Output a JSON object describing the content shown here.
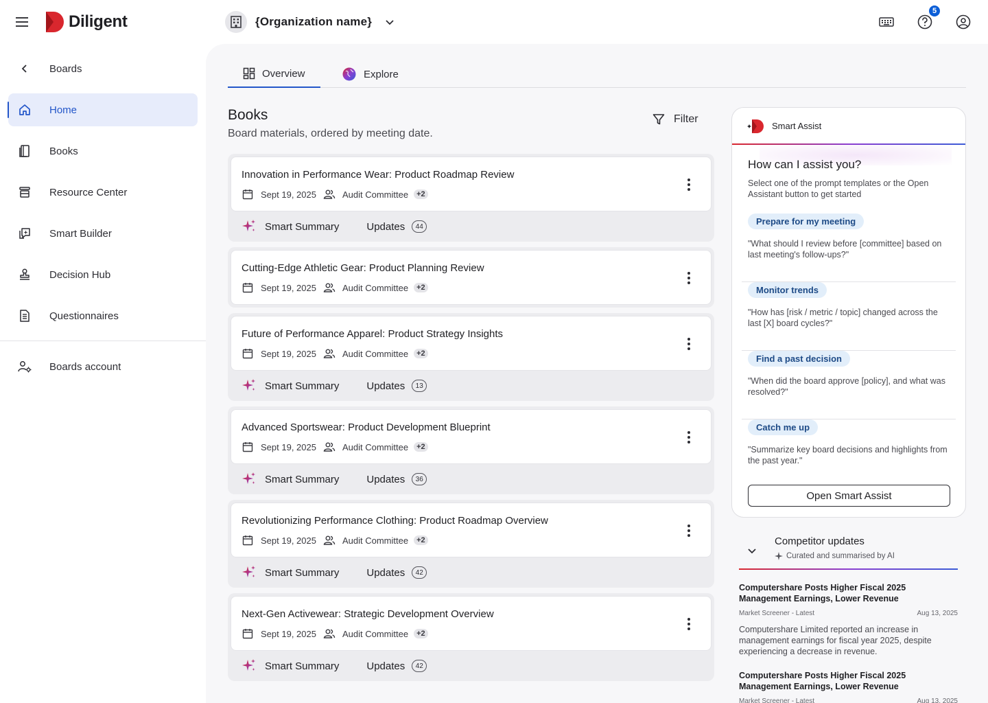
{
  "app": {
    "brand": "Diligent"
  },
  "header": {
    "org_name": "{Organization name}",
    "notification_count": "5"
  },
  "sidebar": {
    "back_label": "Boards",
    "items": [
      {
        "label": "Home",
        "icon": "home-icon",
        "active": true
      },
      {
        "label": "Books",
        "icon": "book-icon"
      },
      {
        "label": "Resource Center",
        "icon": "archive-icon"
      },
      {
        "label": "Smart Builder",
        "icon": "smart-builder-icon"
      },
      {
        "label": "Decision Hub",
        "icon": "stamp-icon"
      },
      {
        "label": "Questionnaires",
        "icon": "document-icon"
      }
    ],
    "account_label": "Boards account"
  },
  "tabs": [
    {
      "label": "Overview",
      "active": true
    },
    {
      "label": "Explore"
    }
  ],
  "books_section": {
    "title": "Books",
    "subtitle": "Board materials, ordered by meeting date.",
    "filter_label": "Filter",
    "footer_summary_label": "Smart Summary",
    "footer_updates_label": "Updates",
    "items": [
      {
        "title": "Innovation in Performance Wear: Product Roadmap Review",
        "date": "Sept 19, 2025",
        "committee": "Audit Committee",
        "extra": "+2",
        "updates": "44"
      },
      {
        "title": "Cutting-Edge Athletic Gear: Product Planning Review",
        "date": "Sept 19, 2025",
        "committee": "Audit Committee",
        "extra": "+2",
        "updates": ""
      },
      {
        "title": "Future of Performance Apparel: Product Strategy Insights",
        "date": "Sept 19, 2025",
        "committee": "Audit Committee",
        "extra": "+2",
        "updates": "13"
      },
      {
        "title": "Advanced Sportswear: Product Development Blueprint",
        "date": "Sept 19, 2025",
        "committee": "Audit Committee",
        "extra": "+2",
        "updates": "36"
      },
      {
        "title": "Revolutionizing Performance Clothing: Product Roadmap Overview",
        "date": "Sept 19, 2025",
        "committee": "Audit Committee",
        "extra": "+2",
        "updates": "42"
      },
      {
        "title": "Next-Gen Activewear: Strategic Development Overview",
        "date": "Sept 19, 2025",
        "committee": "Audit Committee",
        "extra": "+2",
        "updates": "42"
      }
    ]
  },
  "smart_assist": {
    "title": "Smart Assist",
    "question": "How can I assist you?",
    "description": "Select one of the prompt templates or the Open Assistant button to get started",
    "prompts": [
      {
        "label": "Prepare for my meeting",
        "text": "\"What should I review before [committee] based on last meeting's follow-ups?\""
      },
      {
        "label": "Monitor trends",
        "text": "\"How has [risk / metric / topic] changed across the last [X] board cycles?\""
      },
      {
        "label": "Find a past decision",
        "text": "\"When did the board approve [policy], and what was resolved?\""
      },
      {
        "label": "Catch me up",
        "text": "\"Summarize key board decisions and highlights from the past year.\""
      }
    ],
    "open_button": "Open Smart Assist"
  },
  "competitor_updates": {
    "title": "Competitor updates",
    "subtitle": "Curated and summarised by AI",
    "items": [
      {
        "title": "Computershare Posts Higher Fiscal 2025 Management Earnings, Lower Revenue",
        "source": "Market Screener - Latest",
        "date": "Aug 13, 2025",
        "summary": "Computershare Limited reported an increase in management earnings for fiscal year 2025, despite experiencing a decrease in revenue."
      },
      {
        "title": "Computershare Posts Higher Fiscal 2025 Management Earnings, Lower Revenue",
        "source": "Market Screener - Latest",
        "date": "Aug 13, 2025"
      }
    ]
  },
  "colors": {
    "accent": "#2356c9",
    "brand_red": "#d9272e",
    "spark": "#b0278f"
  }
}
